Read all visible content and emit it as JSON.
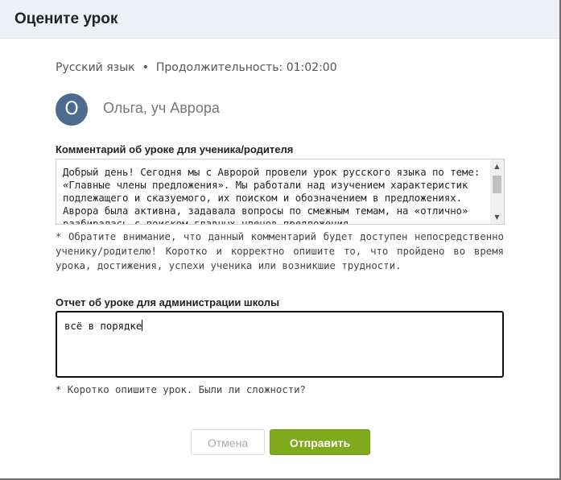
{
  "modal": {
    "title": "Оцените урок"
  },
  "lesson": {
    "subject": "Русский язык",
    "separator": "•",
    "duration_label": "Продолжительность:",
    "duration": "01:02:00"
  },
  "student": {
    "avatar_letter": "О",
    "name": "Ольга, уч Аврора"
  },
  "comment_field": {
    "label": "Комментарий об уроке для ученика/родителя",
    "value": "Добрый день! Сегодня мы с Авророй провели урок русского языка по теме: «Главные члены предложения». Мы работали над изучением характеристик подлежащего и сказуемого, их поиском и обозначением в предложениях. Аврора была активна, задавала вопросы по смежным темам, на «отлично» разбиралась с поиском главных членов предложения.",
    "note": "* Обратите внимание, что данный комментарий будет доступен непосредственно ученику/родителю! Коротко и корректно опишите то, что пройдено во время урока, достижения, успехи ученика или возникшие трудности."
  },
  "report_field": {
    "label": "Отчет об уроке для администрации школы",
    "value": "всё в порядке",
    "note": "* Коротко опишите урок. Были ли сложности?"
  },
  "buttons": {
    "cancel": "Отмена",
    "submit": "Отправить"
  },
  "colors": {
    "header_bg": "#edf1f7",
    "avatar_bg": "#4c6b8e",
    "submit_bg": "#7eaa1c"
  }
}
